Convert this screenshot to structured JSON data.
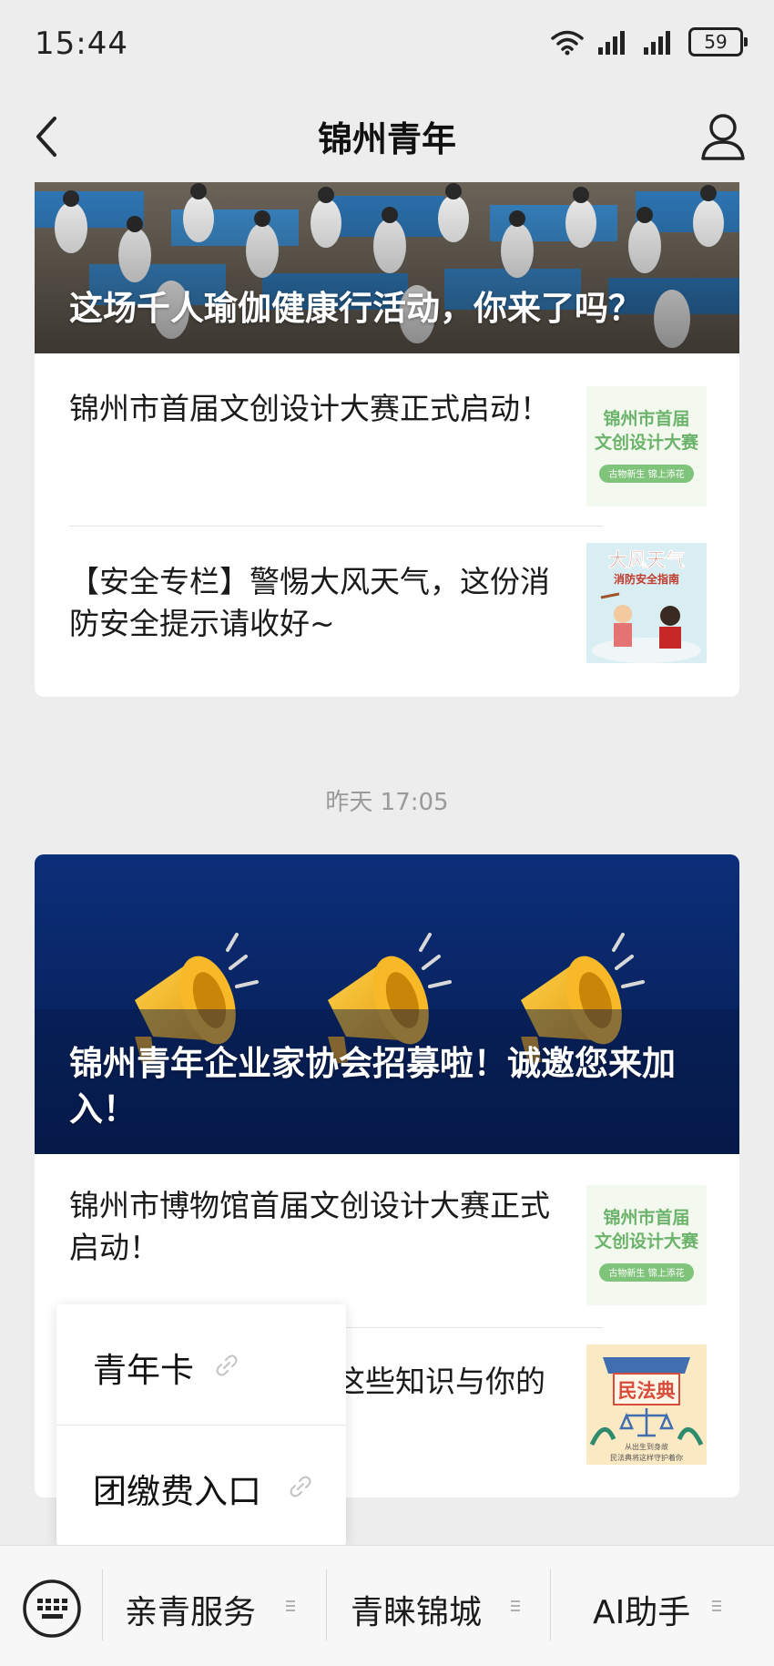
{
  "status_bar": {
    "time": "15:44",
    "battery": "59"
  },
  "nav": {
    "title": "锦州青年"
  },
  "card1": {
    "banner_title": "这场千人瑜伽健康行活动，你来了吗？",
    "items": [
      {
        "title": "锦州市首届文创设计大赛正式启动！",
        "thumb_line1": "锦州市首届",
        "thumb_line2": "文创设计大赛",
        "thumb_sub": "古物新生 锦上添花"
      },
      {
        "title": "【安全专栏】警惕大风天气，这份消防安全提示请收好~",
        "thumb_line1": "大风天气",
        "thumb_line2": "消防安全指南"
      }
    ]
  },
  "timestamp": "昨天 17:05",
  "card2": {
    "banner_title": "锦州青年企业家协会招募啦！诚邀您来加入！",
    "items": [
      {
        "title": "锦州市博物馆首届文创设计大赛正式启动！",
        "thumb_line1": "锦州市首届",
        "thumb_line2": "文创设计大赛",
        "thumb_sub": "古物新生 锦上添花"
      },
      {
        "title_visible": "这些知识与你的",
        "thumb_line1": "民法典",
        "thumb_sub1": "从出生到身故",
        "thumb_sub2": "民法典将这样守护着你"
      }
    ]
  },
  "popup_menu": [
    {
      "label": "青年卡"
    },
    {
      "label": "团缴费入口"
    }
  ],
  "bottom_bar": [
    {
      "label": "亲青服务"
    },
    {
      "label": "青睐锦城"
    },
    {
      "label": "AI助手"
    }
  ]
}
